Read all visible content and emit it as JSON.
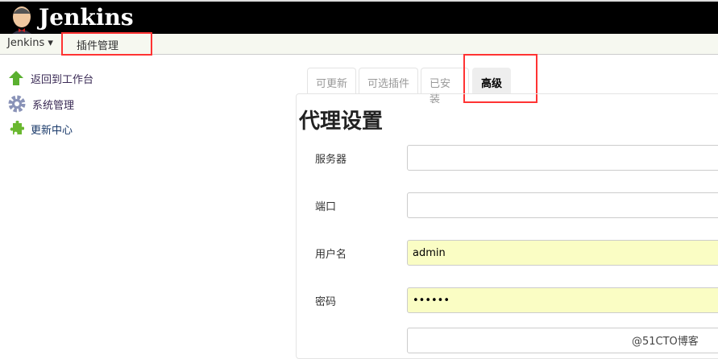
{
  "header": {
    "title": "Jenkins"
  },
  "breadcrumb": {
    "root": "Jenkins",
    "current": "插件管理"
  },
  "sidebar": {
    "items": [
      {
        "label": "返回到工作台",
        "icon": "up-arrow-icon"
      },
      {
        "label": "系统管理",
        "icon": "gear-icon"
      },
      {
        "label": "更新中心",
        "icon": "puzzle-icon"
      }
    ]
  },
  "tabs": [
    {
      "label": "可更新"
    },
    {
      "label": "可选插件"
    },
    {
      "label": "已安装"
    },
    {
      "label": "高级",
      "active": true
    }
  ],
  "proxy": {
    "heading": "代理设置",
    "fields": [
      {
        "label": "服务器",
        "value": ""
      },
      {
        "label": "端口",
        "value": ""
      },
      {
        "label": "用户名",
        "value": "admin"
      },
      {
        "label": "密码",
        "value": "••••••"
      }
    ]
  },
  "watermark": "@51CTO博客"
}
